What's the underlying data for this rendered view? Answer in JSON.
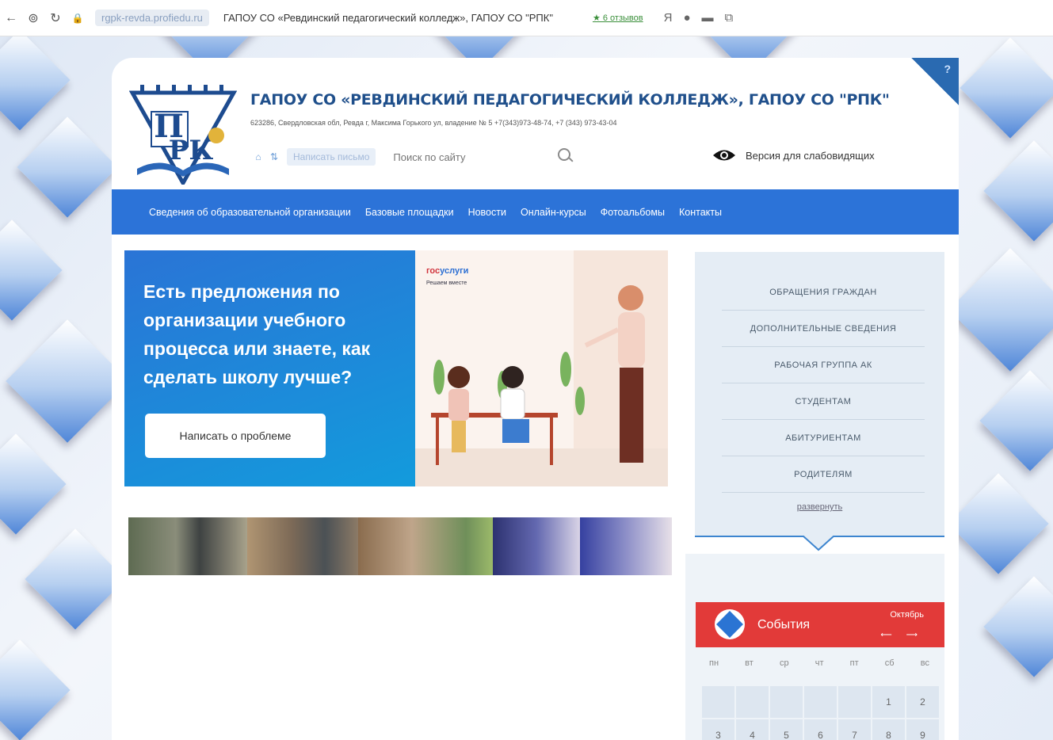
{
  "browser": {
    "url": "rgpk-revda.profiedu.ru",
    "tab_title": "ГАПОУ СО «Ревдинский педагогический колледж», ГАПОУ СО \"РПК\"",
    "reviews": "★ 6 отзывов"
  },
  "header": {
    "logo_letters": "ПРК",
    "title": "ГАПОУ СО «РЕВДИНСКИЙ ПЕДАГОГИЧЕСКИЙ КОЛЛЕДЖ», ГАПОУ СО \"РПК\"",
    "address": "623286, Свердловская обл, Ревда г, Максима Горького ул, владение № 5    +7(343)973-48-74, +7 (343) 973-43-04",
    "write_letter": "Написать письмо",
    "search_placeholder": "Поиск по сайту",
    "low_vision": "Версия для слабовидящих",
    "corner_label": "?"
  },
  "nav": [
    "Сведения об образовательной организации",
    "Базовые площадки",
    "Новости",
    "Онлайн-курсы",
    "Фотоальбомы",
    "Контакты"
  ],
  "promo": {
    "text": "Есть предложения по организации учебного процесса или знаете, как сделать школу лучше?",
    "button": "Написать о проблеме",
    "brand_a": "гос",
    "brand_b": "услуги",
    "brand_sub": "Решаем вместе"
  },
  "sidebar": {
    "items": [
      "ОБРАЩЕНИЯ ГРАЖДАН",
      "ДОПОЛНИТЕЛЬНЫЕ СВЕДЕНИЯ",
      "РАБОЧАЯ ГРУППА АК",
      "СТУДЕНТАМ",
      "АБИТУРИЕНТАМ",
      "РОДИТЕЛЯМ"
    ],
    "expand": "развернуть"
  },
  "events": {
    "title": "События",
    "month": "Октябрь",
    "weekdays": [
      "пн",
      "вт",
      "ср",
      "чт",
      "пт",
      "сб",
      "вс"
    ],
    "days": [
      "",
      "",
      "",
      "",
      "",
      "1",
      "2",
      "3",
      "4",
      "5",
      "6",
      "7",
      "8",
      "9"
    ]
  },
  "colors": {
    "nav": "#2c73d8",
    "events": "#e23a39",
    "title": "#1f4f8b"
  }
}
